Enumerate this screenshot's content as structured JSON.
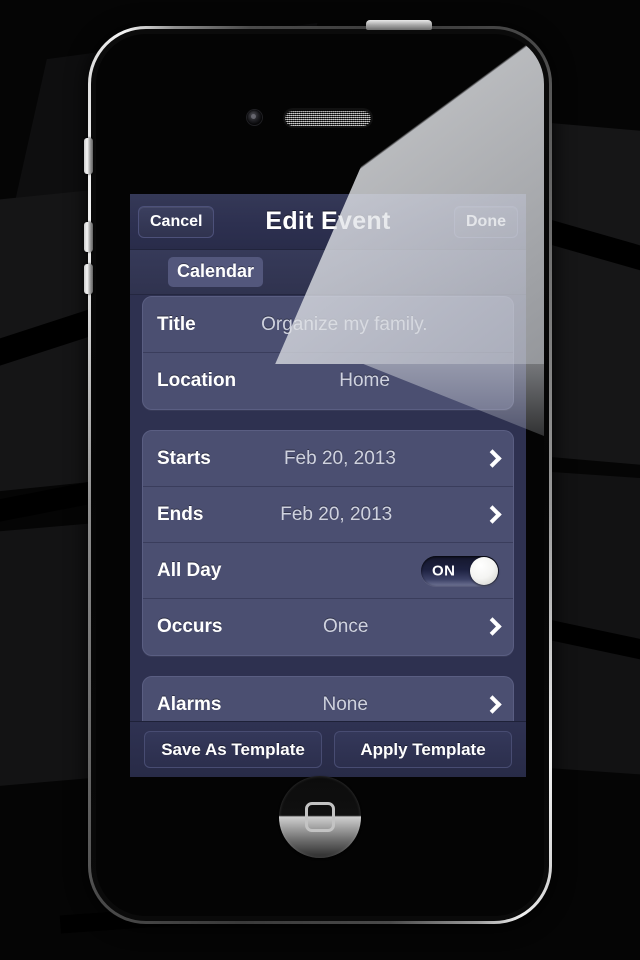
{
  "device": {
    "name": "iPhone 4",
    "hardware": {
      "camera": "front-camera",
      "earpiece": "earpiece-speaker",
      "home_button": "home-button",
      "power_button": "power-button",
      "silence_switch": "silence-switch",
      "volume_up": "volume-up-button",
      "volume_down": "volume-down-button"
    }
  },
  "app": {
    "navbar": {
      "cancel_label": "Cancel",
      "title": "Edit Event",
      "done_label": "Done"
    },
    "calendar_bar": {
      "chip_label": "Calendar"
    },
    "sections": [
      {
        "rows": [
          {
            "label": "Title",
            "value": "Organize my family.",
            "type": "text",
            "chevron": false
          },
          {
            "label": "Location",
            "value": "Home",
            "type": "text",
            "chevron": false
          }
        ]
      },
      {
        "rows": [
          {
            "label": "Starts",
            "value": "Feb 20, 2013",
            "type": "disclosure",
            "chevron": true
          },
          {
            "label": "Ends",
            "value": "Feb 20, 2013",
            "type": "disclosure",
            "chevron": true
          },
          {
            "label": "All Day",
            "value": "ON",
            "type": "toggle",
            "chevron": false
          },
          {
            "label": "Occurs",
            "value": "Once",
            "type": "disclosure",
            "chevron": true
          }
        ]
      },
      {
        "rows": [
          {
            "label": "Alarms",
            "value": "None",
            "type": "disclosure",
            "chevron": true
          }
        ]
      }
    ],
    "toolbar": {
      "save_template_label": "Save As Template",
      "apply_template_label": "Apply Template"
    }
  },
  "colors": {
    "screen_background": "#2e3150",
    "navbar": "#2d3050",
    "group_row": "#4b4f71",
    "label_text": "#ffffff",
    "value_text": "#cfd2df",
    "chip": "#53577c",
    "toggle_track": "#1d2140",
    "toggle_knob": "#ffffff"
  }
}
